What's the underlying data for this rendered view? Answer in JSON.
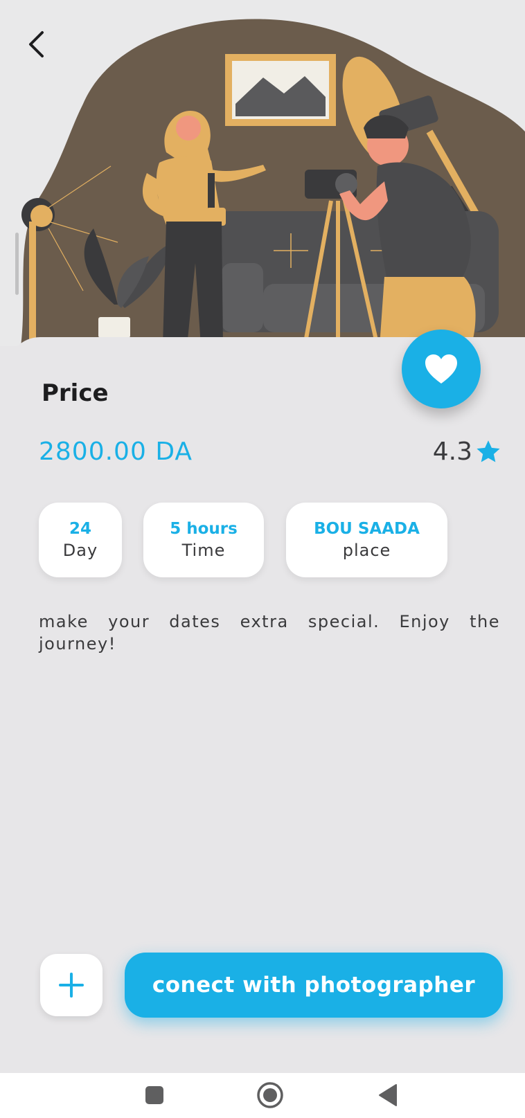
{
  "header": {
    "back_icon": "chevron-left-icon"
  },
  "hero": {
    "illustration": "photographer-photo-shoot-illustration"
  },
  "favorite": {
    "icon": "heart-icon",
    "color": "#1ab0e6"
  },
  "price": {
    "label": "Price",
    "value": "2800.00 DA"
  },
  "rating": {
    "value": "4.3",
    "icon": "star-icon"
  },
  "chips": [
    {
      "value": "24",
      "label": "Day"
    },
    {
      "value": "5 hours",
      "label": "Time"
    },
    {
      "value": "BOU SAADA",
      "label": "place"
    }
  ],
  "description": "make your dates extra special. Enjoy the journey!",
  "actions": {
    "add_icon": "plus-icon",
    "connect_label": "conect with photographer"
  },
  "navbar": {
    "items": [
      "recents-square-icon",
      "home-circle-icon",
      "back-triangle-icon"
    ]
  },
  "colors": {
    "accent": "#1ab0e6",
    "background": "#e7e6e8",
    "text": "#1d1d1f"
  }
}
